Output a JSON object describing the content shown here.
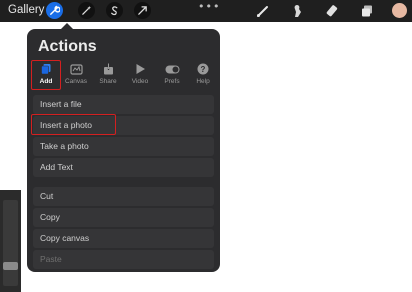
{
  "toolbar": {
    "gallery_label": "Gallery",
    "more_label": "•••",
    "tools": [
      "wrench-icon",
      "magic-wand-icon",
      "selection-icon",
      "transform-arrow-icon"
    ],
    "right_tools": [
      "brush-icon",
      "smudge-icon",
      "eraser-icon",
      "layers-icon"
    ],
    "color_swatch": "#e6b8a2",
    "accent": "#1a6ee8"
  },
  "actions": {
    "title": "Actions",
    "tabs": [
      {
        "label": "Add",
        "icon": "add-icon"
      },
      {
        "label": "Canvas",
        "icon": "canvas-icon"
      },
      {
        "label": "Share",
        "icon": "share-icon"
      },
      {
        "label": "Video",
        "icon": "video-icon"
      },
      {
        "label": "Prefs",
        "icon": "toggle-icon"
      },
      {
        "label": "Help",
        "icon": "help-icon"
      }
    ],
    "items": [
      "Insert a file",
      "Insert a photo",
      "Take a photo",
      "Add Text",
      "Cut",
      "Copy",
      "Copy canvas",
      "Paste"
    ]
  }
}
